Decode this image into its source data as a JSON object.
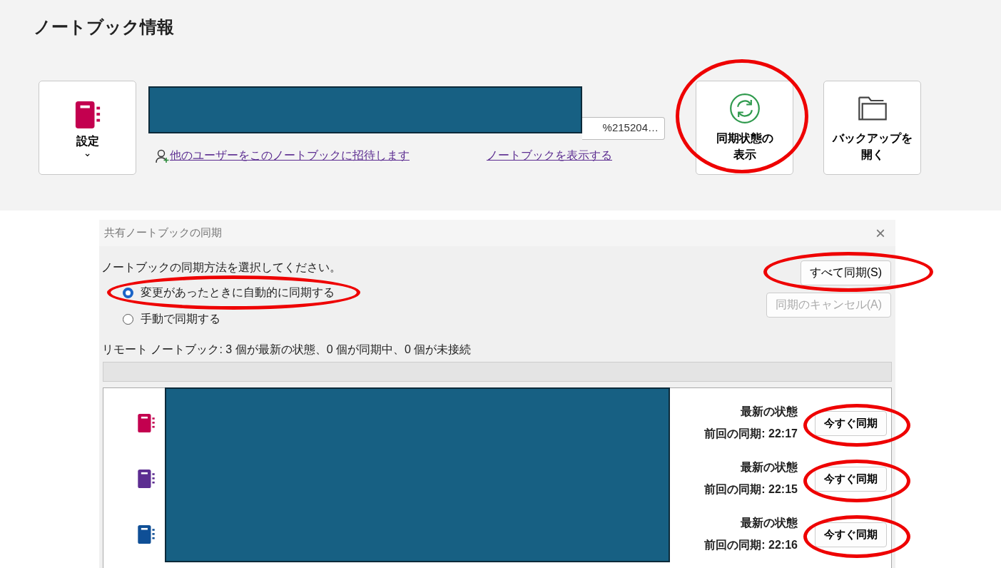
{
  "header": {
    "title": "ノートブック情報"
  },
  "settings_button": {
    "label": "設定",
    "caret": "⌄",
    "color": "#c3004f"
  },
  "url_field": {
    "value": "%215204…",
    "redacted": true
  },
  "links": [
    {
      "label": "他のユーザーをこのノートブックに招待します",
      "kind": "invite"
    },
    {
      "label": "ノートブックを表示する",
      "kind": "plain"
    }
  ],
  "action_buttons": [
    {
      "label_lines": [
        "同期状態の",
        "表示"
      ],
      "kind": "sync",
      "highlighted": true
    },
    {
      "label_lines": [
        "バックアップを",
        "開く"
      ],
      "kind": "folder",
      "highlighted": false
    }
  ],
  "dialog": {
    "title": "共有ノートブックの同期",
    "close": "×",
    "prompt": "ノートブックの同期方法を選択してください。",
    "options": [
      {
        "label": "変更があったときに自動的に同期する",
        "selected": true,
        "highlighted": true
      },
      {
        "label": "手動で同期する",
        "selected": false,
        "highlighted": false
      }
    ],
    "buttons": [
      {
        "label": "すべて同期(S)",
        "disabled": false,
        "highlighted": true
      },
      {
        "label": "同期のキャンセル(A)",
        "disabled": true,
        "highlighted": false
      }
    ],
    "status": "リモート ノートブック: 3 個が最新の状態、0 個が同期中、0 個が未接続",
    "progress": {
      "level": 0
    },
    "notebooks_redacted": true,
    "notebooks": [
      {
        "color": "#c3004f",
        "state": "最新の状態",
        "last_sync": "前回の同期: 22:17",
        "button": "今すぐ同期",
        "highlighted": true
      },
      {
        "color": "#5c2d91",
        "state": "最新の状態",
        "last_sync": "前回の同期: 22:15",
        "button": "今すぐ同期",
        "highlighted": true
      },
      {
        "color": "#0f4f96",
        "state": "最新の状態",
        "last_sync": "前回の同期: 22:16",
        "button": "今すぐ同期",
        "highlighted": true
      }
    ]
  }
}
